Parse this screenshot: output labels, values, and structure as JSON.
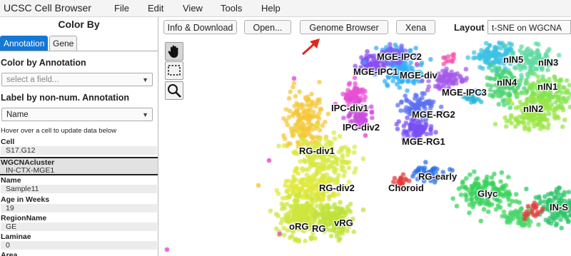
{
  "app": {
    "title": "UCSC Cell Browser"
  },
  "menu": {
    "items": [
      "File",
      "Edit",
      "View",
      "Tools",
      "Help"
    ]
  },
  "sidebar": {
    "title": "Color By",
    "tabs": [
      "Annotation",
      "Gene"
    ],
    "color_by_label": "Color by Annotation",
    "color_by_placeholder": "select a field...",
    "label_by_label": "Label by non-num. Annotation",
    "label_by_value": "Name",
    "hint": "Hover over a cell to update data below",
    "metadata": [
      {
        "key": "Cell",
        "value": "S17.G12"
      },
      {
        "key": "WGCNAcluster",
        "value": "IN-CTX-MGE1"
      },
      {
        "key": "Name",
        "value": "Sample11"
      },
      {
        "key": "Age in Weeks",
        "value": "19"
      },
      {
        "key": "RegionName",
        "value": "GE"
      },
      {
        "key": "Laminae",
        "value": "0"
      },
      {
        "key": "Area",
        "value": ""
      }
    ]
  },
  "toolbar": {
    "buttons": [
      "Info & Download",
      "Open...",
      "Genome Browser",
      "Xena"
    ],
    "layout_label": "Layout",
    "layout_value": "t-SNE on WGCNA"
  },
  "plot": {
    "clusters": [
      {
        "name": "MGE-IPC2",
        "color": "#7b61ff"
      },
      {
        "name": "MGE-IPC1",
        "color": "#8a4df0"
      },
      {
        "name": "MGE-div",
        "color": "#3aa9f0"
      },
      {
        "name": "MGE-IPC3",
        "color": "#9f50e8"
      },
      {
        "name": "IPC-div1",
        "color": "#e94fd3"
      },
      {
        "name": "IPC-div2",
        "color": "#c84de0"
      },
      {
        "name": "MGE-RG2",
        "color": "#5a6ff0"
      },
      {
        "name": "MGE-RG1",
        "color": "#7a4ff5"
      },
      {
        "name": "RG-div1",
        "color": "#f0d33e"
      },
      {
        "name": "RG-div2",
        "color": "#d7ea46"
      },
      {
        "name": "RG-early",
        "color": "#2d6fe8"
      },
      {
        "name": "Choroid",
        "color": "#e43b3b"
      },
      {
        "name": "Glyc",
        "color": "#37d25a"
      },
      {
        "name": "nIN5",
        "color": "#3ec1e3"
      },
      {
        "name": "nIN3",
        "color": "#5fd9a0"
      },
      {
        "name": "nIN4",
        "color": "#4bd370"
      },
      {
        "name": "nIN1",
        "color": "#84e352"
      },
      {
        "name": "nIN2",
        "color": "#9be646"
      },
      {
        "name": "oRG",
        "color": "#cde53f"
      },
      {
        "name": "RG",
        "color": "#bfe13a"
      },
      {
        "name": "vRG",
        "color": "#d3e93f"
      },
      {
        "name": "IN-S",
        "color": "#2ec46a"
      }
    ]
  }
}
